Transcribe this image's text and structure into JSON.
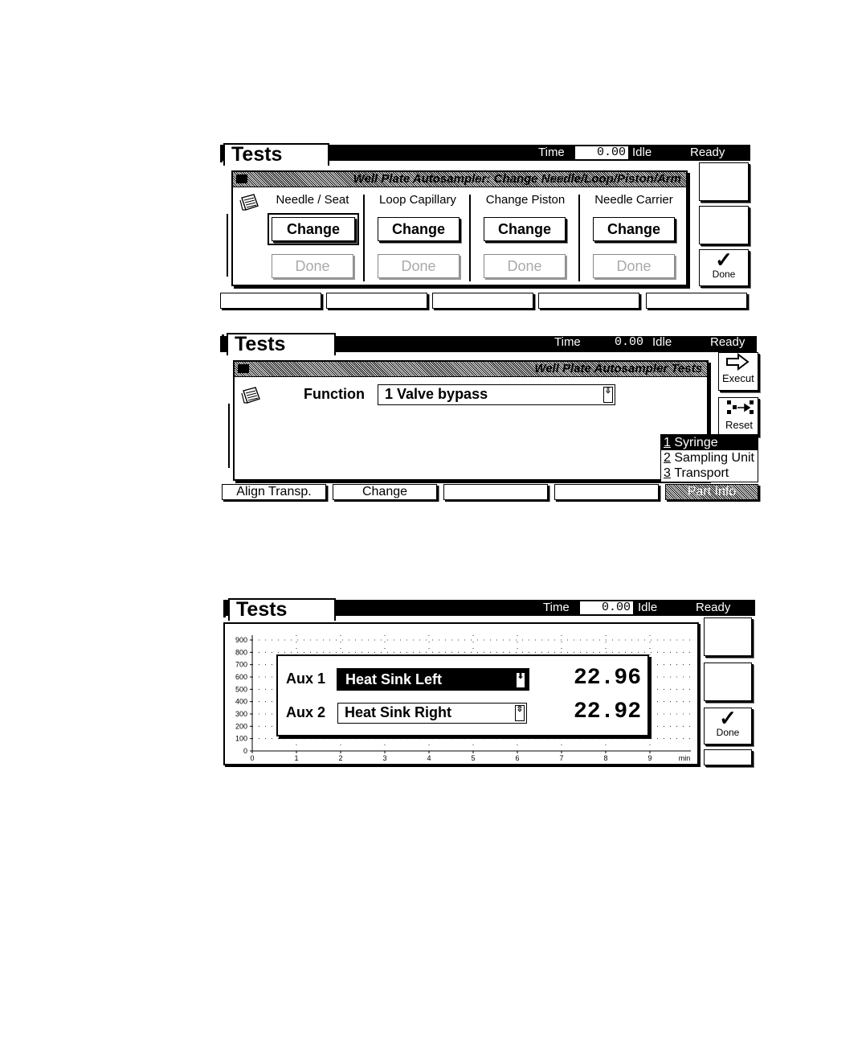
{
  "screens": [
    {
      "tab": "Tests",
      "status": {
        "time_label": "Time",
        "time_value": "0.00",
        "idle": "Idle",
        "ready": "Ready"
      },
      "panel_title": "Well Plate Autosampler: Change Needle/Loop/Piston/Arm",
      "columns": [
        {
          "header": "Needle / Seat",
          "change": "Change",
          "done": "Done"
        },
        {
          "header": "Loop Capillary",
          "change": "Change",
          "done": "Done"
        },
        {
          "header": "Change Piston",
          "change": "Change",
          "done": "Done"
        },
        {
          "header": "Needle Carrier",
          "change": "Change",
          "done": "Done"
        }
      ],
      "side_buttons": [
        "",
        "",
        "Done"
      ],
      "bottom_buttons": [
        "",
        "",
        "",
        "",
        ""
      ]
    },
    {
      "tab": "Tests",
      "status": {
        "time_label": "Time",
        "time_value": "0.00",
        "idle": "Idle",
        "ready": "Ready"
      },
      "panel_title": "Well Plate Autosampler Tests",
      "function_label": "Function",
      "function_value": "1 Valve bypass",
      "side_buttons": [
        "Execut",
        "Reset"
      ],
      "menu": [
        {
          "key": "1",
          "label": "Syringe",
          "selected": true
        },
        {
          "key": "2",
          "label": "Sampling Unit",
          "selected": false
        },
        {
          "key": "3",
          "label": "Transport",
          "selected": false
        }
      ],
      "bottom_buttons": [
        "Align Transp.",
        "Change",
        "",
        "",
        "Part Info"
      ]
    },
    {
      "tab": "Tests",
      "status": {
        "time_label": "Time",
        "time_value": "0.00",
        "idle": "Idle",
        "ready": "Ready"
      },
      "aux": [
        {
          "label": "Aux 1",
          "sensor": "Heat Sink Left",
          "value": "22.96"
        },
        {
          "label": "Aux 2",
          "sensor": "Heat Sink Right",
          "value": "22.92"
        }
      ],
      "side_buttons": [
        "",
        "",
        "Done"
      ],
      "chart": {
        "y_ticks": [
          "900",
          "800",
          "700",
          "600",
          "500",
          "400",
          "300",
          "200",
          "100",
          "0"
        ],
        "x_ticks": [
          "0",
          "1",
          "2",
          "3",
          "4",
          "5",
          "6",
          "7",
          "8",
          "9"
        ],
        "x_unit": "min"
      }
    }
  ]
}
